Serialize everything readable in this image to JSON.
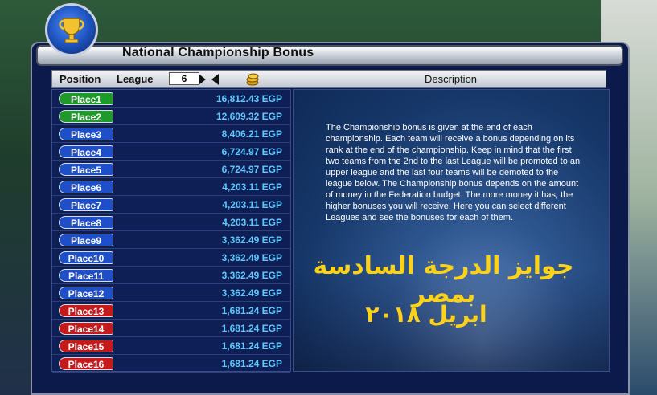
{
  "window": {
    "title": "National Championship Bonus"
  },
  "header": {
    "position_label": "Position",
    "league_label": "League",
    "league_value": "6",
    "description_label": "Description",
    "coins_icon": "coins-icon"
  },
  "places": [
    {
      "label": "Place1",
      "amount": "16,812.43 EGP",
      "color": "#1f9a2a"
    },
    {
      "label": "Place2",
      "amount": "12,609.32 EGP",
      "color": "#1f9a2a"
    },
    {
      "label": "Place3",
      "amount": "8,406.21 EGP",
      "color": "#1f4fc8"
    },
    {
      "label": "Place4",
      "amount": "6,724.97 EGP",
      "color": "#1f4fc8"
    },
    {
      "label": "Place5",
      "amount": "6,724.97 EGP",
      "color": "#1f4fc8"
    },
    {
      "label": "Place6",
      "amount": "4,203.11 EGP",
      "color": "#1f4fc8"
    },
    {
      "label": "Place7",
      "amount": "4,203.11 EGP",
      "color": "#1f4fc8"
    },
    {
      "label": "Place8",
      "amount": "4,203.11 EGP",
      "color": "#1f4fc8"
    },
    {
      "label": "Place9",
      "amount": "3,362.49 EGP",
      "color": "#1f4fc8"
    },
    {
      "label": "Place10",
      "amount": "3,362.49 EGP",
      "color": "#1f4fc8"
    },
    {
      "label": "Place11",
      "amount": "3,362.49 EGP",
      "color": "#1f4fc8"
    },
    {
      "label": "Place12",
      "amount": "3,362.49 EGP",
      "color": "#1f4fc8"
    },
    {
      "label": "Place13",
      "amount": "1,681.24 EGP",
      "color": "#c41a1a"
    },
    {
      "label": "Place14",
      "amount": "1,681.24 EGP",
      "color": "#c41a1a"
    },
    {
      "label": "Place15",
      "amount": "1,681.24 EGP",
      "color": "#c41a1a"
    },
    {
      "label": "Place16",
      "amount": "1,681.24 EGP",
      "color": "#c41a1a"
    }
  ],
  "description": {
    "text": "The Championship bonus is given at the end of each championship. Each team will receive a bonus depending on its rank at the end of the championship. Keep in mind that the first two teams from the 2nd to the last League will be promoted to an upper league and the last four teams will be demoted to the league below. The Championship bonus depends on the amount of money in the Federation budget. The more money it has, the higher bonuses you will receive. Here you can select different Leagues and see the bonuses for each of them."
  },
  "overlay": {
    "line1": "جوايز الدرجة السادسة بمصر",
    "line2": "ابريل ٢٠١٨"
  },
  "colors": {
    "amount_text": "#5fc8ff",
    "overlay_text": "#ffd21a"
  }
}
